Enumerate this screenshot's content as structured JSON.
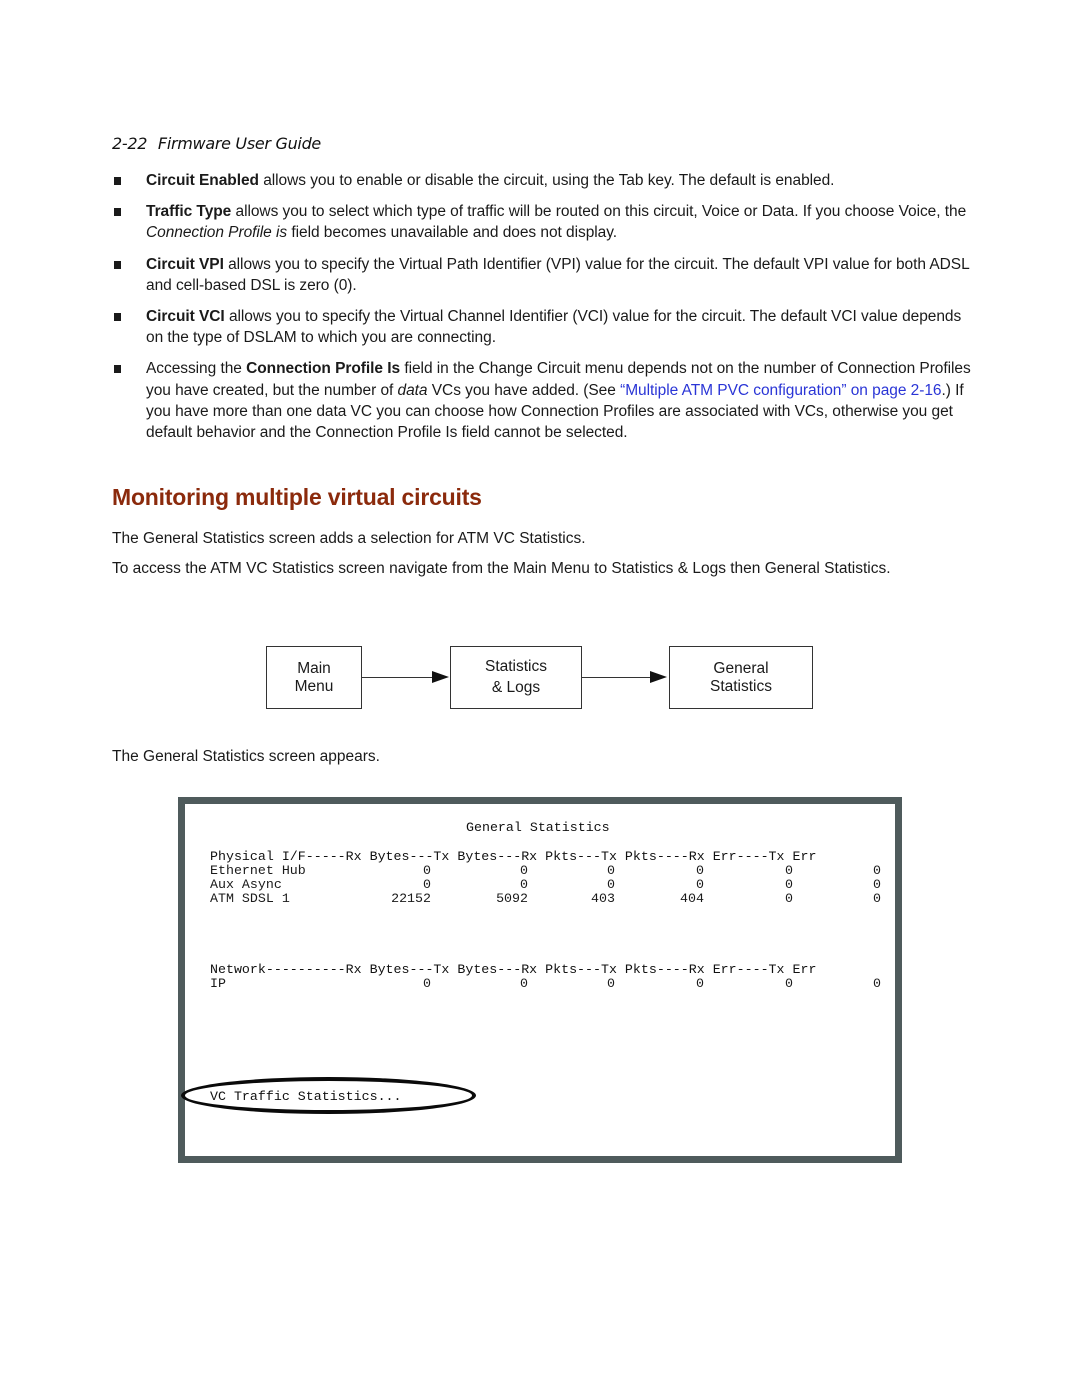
{
  "header": {
    "page_number": "2-22",
    "title": "Firmware User Guide"
  },
  "bullets": [
    {
      "term": "Circuit Enabled",
      "text": " allows you to enable or disable the circuit, using the Tab key. The default is enabled."
    },
    {
      "term": "Traffic Type",
      "text_a": " allows you to select which type of traffic will be routed on this circuit, Voice or Data. If you choose Voice, the ",
      "italic": "Connection Profile is",
      "text_b": " field becomes unavailable and does not display."
    },
    {
      "term": "Circuit VPI",
      "text": " allows you to specify the Virtual Path Identifier (VPI) value for the circuit. The default VPI value for both ADSL and cell-based DSL is zero (0)."
    },
    {
      "term": "Circuit VCI",
      "text": " allows you to specify the Virtual Channel Identifier (VCI) value for the circuit. The default VCI value depends on the type of DSLAM to which you are connecting."
    },
    {
      "lead": "Accessing the ",
      "term": "Connection Profile Is",
      "text_a": " field in the Change Circuit menu depends not on the number of Connection Profiles you have created, but the number of ",
      "italic": "data",
      "text_b": " VCs you have added. (See ",
      "link": "“Multiple ATM PVC configuration” on page 2-16",
      "text_c": ".) If you have more than one data VC you can choose how Connection Profiles are associated with VCs, otherwise you get default behavior and the Connection Profile Is field cannot be selected."
    }
  ],
  "section": {
    "title": "Monitoring multiple virtual circuits",
    "para1": "The General Statistics screen adds a selection for ATM VC Statistics.",
    "para2": "To access the ATM VC Statistics screen navigate from the Main Menu to Statistics & Logs then General Statistics.",
    "para3": "The General Statistics screen appears."
  },
  "flow": [
    {
      "line1": "Main",
      "line2": "Menu"
    },
    {
      "line1": "Statistics",
      "line2": "& Logs"
    },
    {
      "line1": "General",
      "line2": "Statistics"
    }
  ],
  "screen": {
    "title": "General Statistics",
    "physical_header": "Physical I/F-----Rx Bytes---Tx Bytes---Rx Pkts---Tx Pkts----Rx Err----Tx Err",
    "physical_rows": [
      {
        "name": "Ethernet Hub",
        "values": [
          "0",
          "0",
          "0",
          "0",
          "0",
          "0"
        ]
      },
      {
        "name": "Aux Async",
        "values": [
          "0",
          "0",
          "0",
          "0",
          "0",
          "0"
        ]
      },
      {
        "name": "ATM SDSL 1",
        "values": [
          "22152",
          "5092",
          "403",
          "404",
          "0",
          "0"
        ]
      }
    ],
    "network_header": "Network----------Rx Bytes---Tx Bytes---Rx Pkts---Tx Pkts----Rx Err----Tx Err",
    "network_rows": [
      {
        "name": "IP",
        "values": [
          "0",
          "0",
          "0",
          "0",
          "0",
          "0"
        ]
      }
    ],
    "vc_link": "VC Traffic Statistics..."
  }
}
